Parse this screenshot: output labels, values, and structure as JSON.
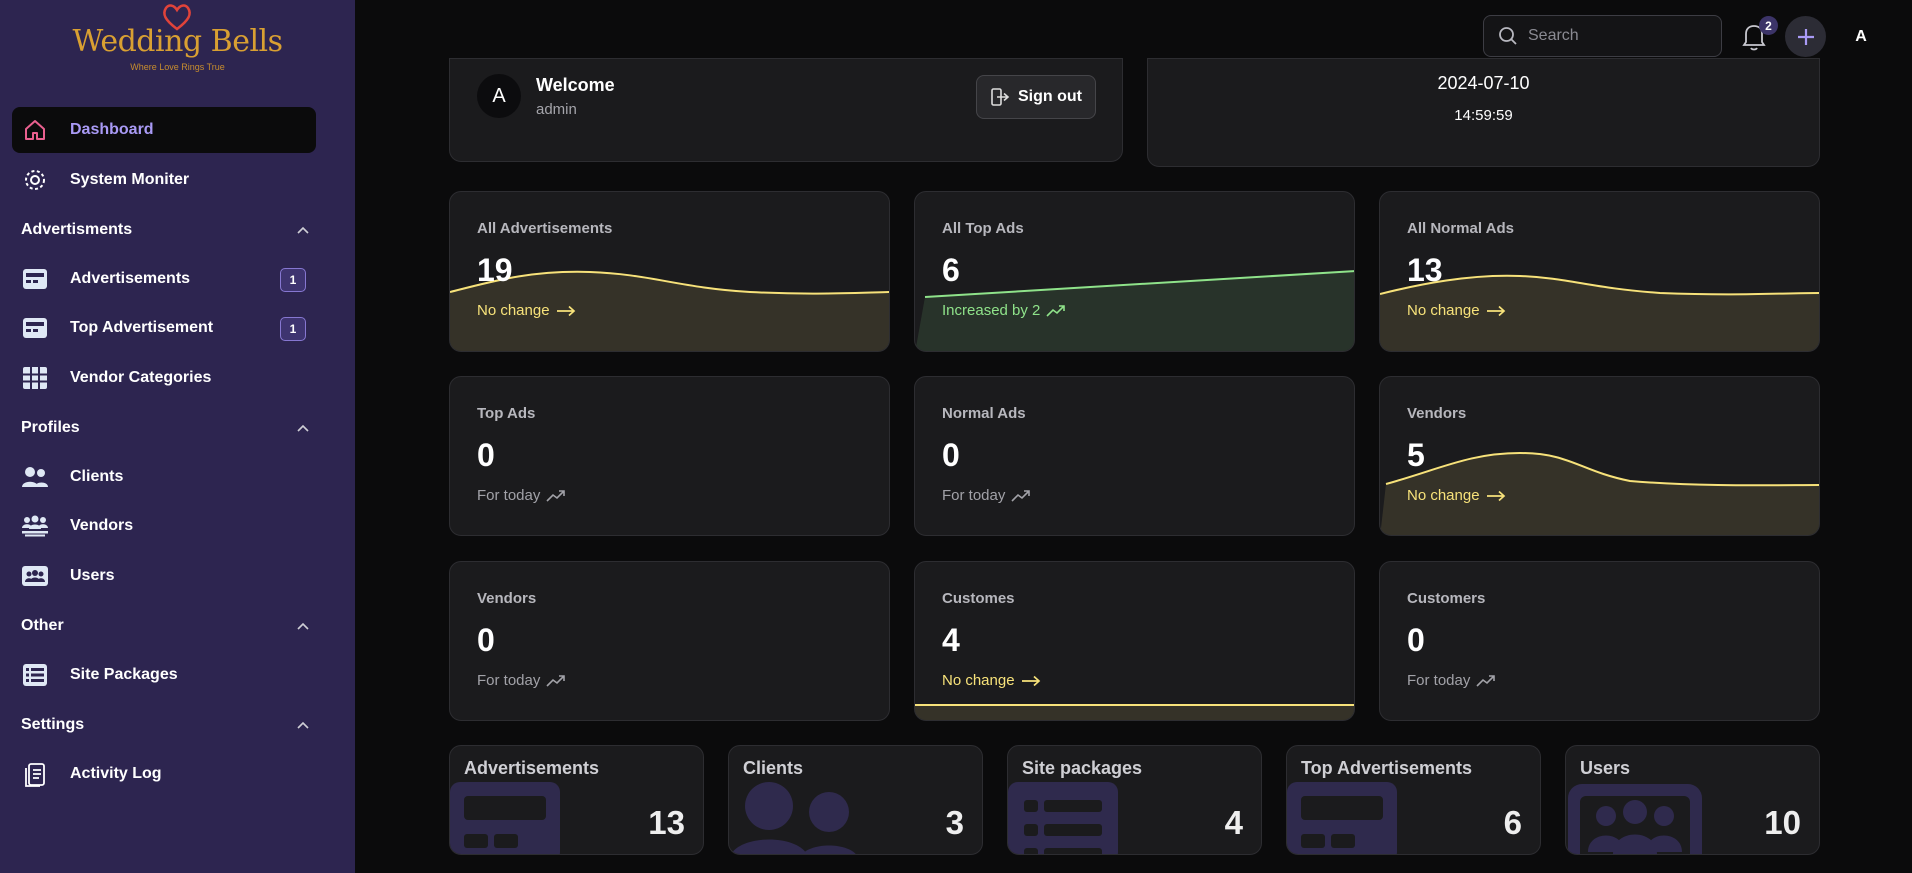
{
  "brand": {
    "title": "Wedding Bells",
    "tagline": "Where Love Rings True"
  },
  "sidebar": {
    "dashboard": "Dashboard",
    "system_monitor": "System Moniter",
    "sections": {
      "advertisments": "Advertisments",
      "profiles": "Profiles",
      "other": "Other",
      "settings": "Settings"
    },
    "advertisements": {
      "label": "Advertisements",
      "badge": "1"
    },
    "top_advertisement": {
      "label": "Top Advertisement",
      "badge": "1"
    },
    "vendor_categories": "Vendor Categories",
    "clients": "Clients",
    "vendors": "Vendors",
    "users": "Users",
    "site_packages": "Site Packages",
    "activity_log": "Activity Log"
  },
  "topbar": {
    "search_placeholder": "Search",
    "notifications_count": "2",
    "avatar_letter": "A"
  },
  "welcome": {
    "avatar_letter": "A",
    "title": "Welcome",
    "user": "admin",
    "signout_label": "Sign out"
  },
  "clock": {
    "date": "2024-07-10",
    "time": "14:59:59"
  },
  "stats": [
    {
      "label": "All Advertisements",
      "value": "19",
      "note": "No change",
      "trend": "flat",
      "tone": "yellow"
    },
    {
      "label": "All Top Ads",
      "value": "6",
      "note": "Increased by 2",
      "trend": "up",
      "tone": "green"
    },
    {
      "label": "All Normal Ads",
      "value": "13",
      "note": "No change",
      "trend": "flat",
      "tone": "yellow"
    },
    {
      "label": "Top Ads",
      "value": "0",
      "note": "For today",
      "trend": "up",
      "tone": "gray"
    },
    {
      "label": "Normal Ads",
      "value": "0",
      "note": "For today",
      "trend": "up",
      "tone": "gray"
    },
    {
      "label": "Vendors",
      "value": "5",
      "note": "No change",
      "trend": "flat",
      "tone": "yellow"
    },
    {
      "label": "Vendors",
      "value": "0",
      "note": "For today",
      "trend": "up",
      "tone": "gray"
    },
    {
      "label": "Customes",
      "value": "4",
      "note": "No change",
      "trend": "flat",
      "tone": "yellow"
    },
    {
      "label": "Customers",
      "value": "0",
      "note": "For today",
      "trend": "up",
      "tone": "gray"
    }
  ],
  "summary": [
    {
      "label": "Advertisements",
      "value": "13",
      "icon": "ad-card-icon"
    },
    {
      "label": "Clients",
      "value": "3",
      "icon": "people-icon"
    },
    {
      "label": "Site packages",
      "value": "4",
      "icon": "list-icon"
    },
    {
      "label": "Top Advertisements",
      "value": "6",
      "icon": "ad-card-icon"
    },
    {
      "label": "Users",
      "value": "10",
      "icon": "users-group-icon"
    }
  ],
  "colors": {
    "sidebar": "#2d2550",
    "accent": "#a99af5",
    "card": "#1b1b1d",
    "trend_yellow": "#f7e27a",
    "trend_green": "#8fe38a"
  }
}
